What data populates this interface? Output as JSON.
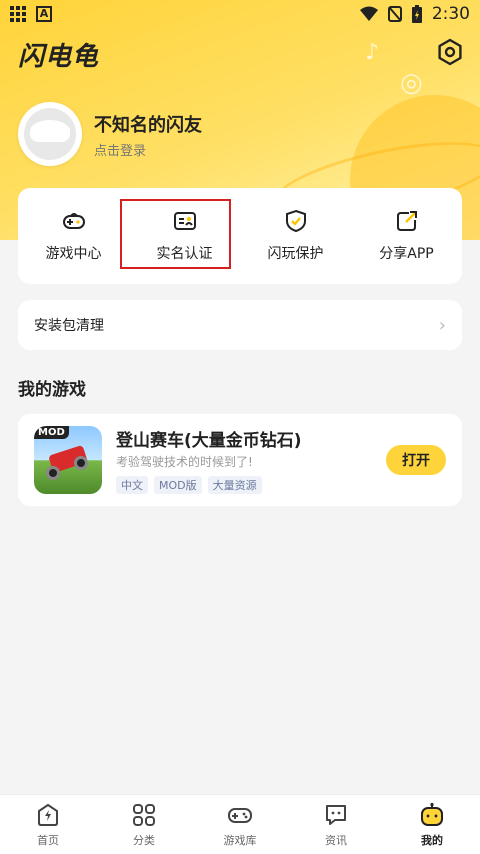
{
  "status_bar": {
    "time": "2:30",
    "a_badge": "A"
  },
  "app": {
    "title": "闪电龟"
  },
  "user": {
    "name": "不知名的闪友",
    "login_hint": "点击登录"
  },
  "quick_actions": [
    {
      "label": "游戏中心",
      "icon": "gamepad-icon"
    },
    {
      "label": "实名认证",
      "icon": "id-card-icon"
    },
    {
      "label": "闪玩保护",
      "icon": "shield-check-icon"
    },
    {
      "label": "分享APP",
      "icon": "share-icon"
    }
  ],
  "clean": {
    "label": "安装包清理"
  },
  "section": {
    "my_games": "我的游戏"
  },
  "game": {
    "title": "登山赛车(大量金币钻石)",
    "description": "考验驾驶技术的时候到了!",
    "badge": "MOD",
    "tags": [
      "中文",
      "MOD版",
      "大量资源"
    ],
    "action": "打开"
  },
  "tabs": [
    {
      "label": "首页",
      "icon": "home-bolt-icon"
    },
    {
      "label": "分类",
      "icon": "category-icon"
    },
    {
      "label": "游戏库",
      "icon": "gamepad-icon"
    },
    {
      "label": "资讯",
      "icon": "news-icon"
    },
    {
      "label": "我的",
      "icon": "profile-robot-icon",
      "active": true
    }
  ],
  "colors": {
    "accent": "#ffd43a",
    "highlight_border": "#d62020"
  }
}
